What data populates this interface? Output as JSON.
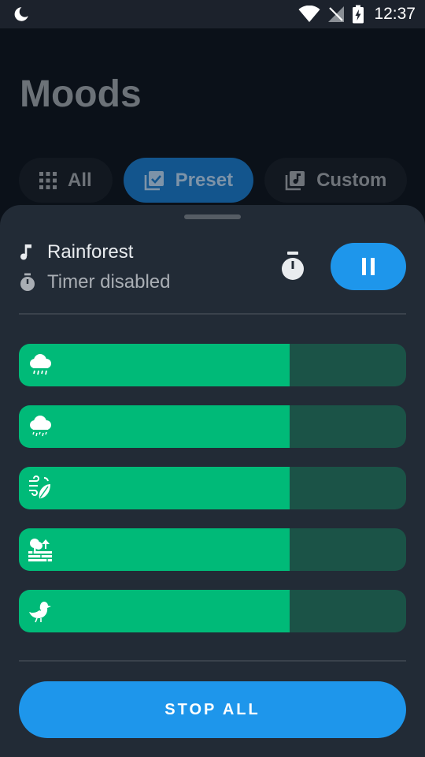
{
  "status_bar": {
    "time": "12:37"
  },
  "page": {
    "title": "Moods"
  },
  "filters": [
    {
      "label": "All",
      "icon": "grid-icon",
      "selected": false
    },
    {
      "label": "Preset",
      "icon": "checkbox-library-icon",
      "selected": true
    },
    {
      "label": "Custom",
      "icon": "music-library-icon",
      "selected": false
    }
  ],
  "now_playing": {
    "sound_name": "Rainforest",
    "timer_status": "Timer disabled"
  },
  "sound_sliders": [
    {
      "icon": "heavy-rain-cloud-icon",
      "volume": 0.7
    },
    {
      "icon": "light-rain-cloud-icon",
      "volume": 0.7
    },
    {
      "icon": "windy-leaves-icon",
      "volume": 0.7
    },
    {
      "icon": "forest-trees-icon",
      "volume": 0.7
    },
    {
      "icon": "bird-icon",
      "volume": 0.7
    }
  ],
  "actions": {
    "stop_all": "STOP ALL"
  },
  "colors": {
    "accent": "#1e96eb",
    "slider_fill": "#00ba78",
    "slider_track": "#1b5347",
    "sheet": "#222b36"
  }
}
